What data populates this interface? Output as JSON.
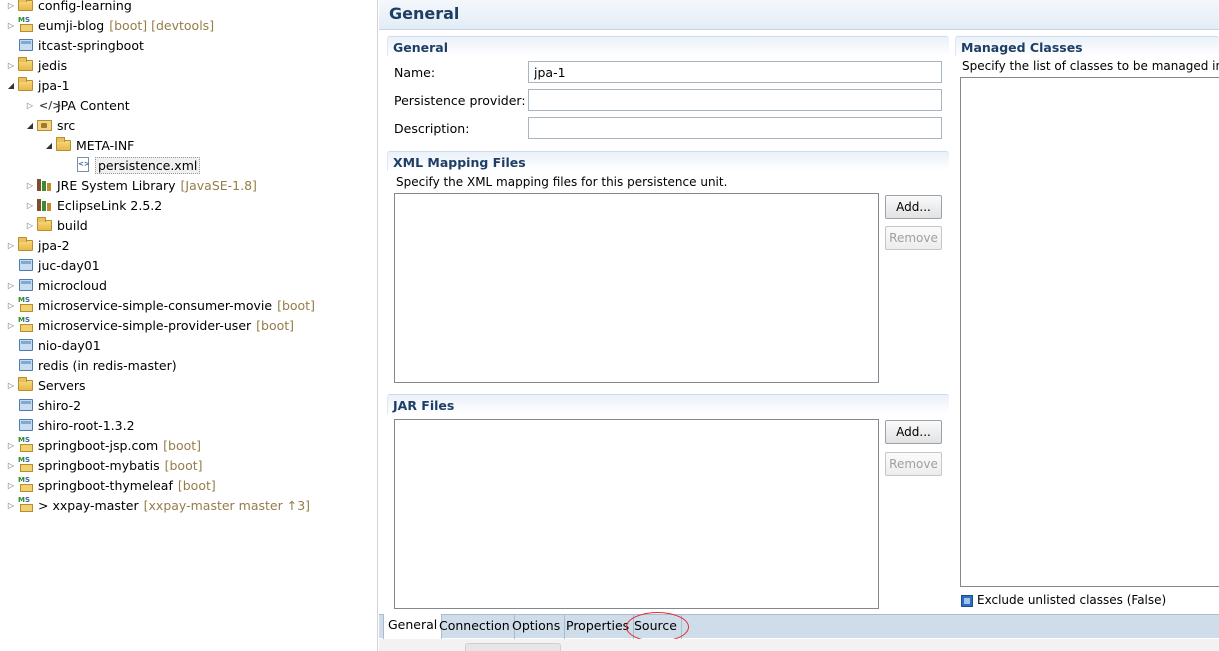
{
  "explorer": {
    "items": [
      {
        "label": "config-learning",
        "decoration": "",
        "icon": "folder-icon",
        "arrow": "collapsed",
        "level": 0
      },
      {
        "label": "eumji-blog",
        "decoration": "[boot] [devtools]",
        "icon": "spring-project-icon",
        "arrow": "collapsed",
        "level": 0
      },
      {
        "label": "itcast-springboot",
        "decoration": "",
        "icon": "project-icon",
        "arrow": "none",
        "level": 0
      },
      {
        "label": "jedis",
        "decoration": "",
        "icon": "folder-icon",
        "arrow": "collapsed",
        "level": 0
      },
      {
        "label": "jpa-1",
        "decoration": "",
        "icon": "folder-icon",
        "arrow": "expanded",
        "level": 0
      },
      {
        "label": "JPA Content",
        "decoration": "",
        "icon": "jpa-content-icon",
        "arrow": "collapsed",
        "level": 1
      },
      {
        "label": "src",
        "decoration": "",
        "icon": "source-folder-icon",
        "arrow": "expanded",
        "level": 1
      },
      {
        "label": "META-INF",
        "decoration": "",
        "icon": "folder-icon",
        "arrow": "expanded",
        "level": 2
      },
      {
        "label": "persistence.xml",
        "decoration": "",
        "icon": "xml-file-icon",
        "arrow": "none",
        "level": 3
      },
      {
        "label": "JRE System Library",
        "decoration": "[JavaSE-1.8]",
        "icon": "library-icon",
        "arrow": "collapsed",
        "level": 1
      },
      {
        "label": "EclipseLink 2.5.2",
        "decoration": "",
        "icon": "library-icon",
        "arrow": "collapsed",
        "level": 1
      },
      {
        "label": "build",
        "decoration": "",
        "icon": "folder-icon",
        "arrow": "collapsed",
        "level": 1
      },
      {
        "label": "jpa-2",
        "decoration": "",
        "icon": "folder-icon",
        "arrow": "collapsed",
        "level": 0
      },
      {
        "label": "juc-day01",
        "decoration": "",
        "icon": "project-icon",
        "arrow": "none",
        "level": 0
      },
      {
        "label": "microcloud",
        "decoration": "",
        "icon": "project-icon",
        "arrow": "collapsed",
        "level": 0
      },
      {
        "label": "microservice-simple-consumer-movie",
        "decoration": "[boot]",
        "icon": "spring-project-icon",
        "arrow": "collapsed",
        "level": 0
      },
      {
        "label": "microservice-simple-provider-user",
        "decoration": "[boot]",
        "icon": "spring-project-icon",
        "arrow": "collapsed",
        "level": 0
      },
      {
        "label": "nio-day01",
        "decoration": "",
        "icon": "project-icon",
        "arrow": "none",
        "level": 0
      },
      {
        "label": "redis (in redis-master)",
        "decoration": "",
        "icon": "project-icon",
        "arrow": "none",
        "level": 0
      },
      {
        "label": "Servers",
        "decoration": "",
        "icon": "folder-icon",
        "arrow": "collapsed",
        "level": 0
      },
      {
        "label": "shiro-2",
        "decoration": "",
        "icon": "project-icon",
        "arrow": "none",
        "level": 0
      },
      {
        "label": "shiro-root-1.3.2",
        "decoration": "",
        "icon": "project-icon",
        "arrow": "none",
        "level": 0
      },
      {
        "label": "springboot-jsp.com",
        "decoration": "[boot]",
        "icon": "spring-project-icon",
        "arrow": "collapsed",
        "level": 0
      },
      {
        "label": "springboot-mybatis",
        "decoration": "[boot]",
        "icon": "spring-project-icon",
        "arrow": "collapsed",
        "level": 0
      },
      {
        "label": "springboot-thymeleaf",
        "decoration": "[boot]",
        "icon": "spring-project-icon",
        "arrow": "collapsed",
        "level": 0
      },
      {
        "label": "xxpay-master",
        "git_prefix": ">",
        "decoration": "[xxpay-master master ↑3]",
        "icon": "git-project-icon",
        "arrow": "collapsed",
        "level": 0
      }
    ],
    "selected_index": 8
  },
  "editor": {
    "title": "General",
    "general": {
      "title": "General",
      "name_label": "Name:",
      "name_value": "jpa-1",
      "provider_label": "Persistence provider:",
      "provider_value": "",
      "description_label": "Description:",
      "description_value": ""
    },
    "xml_mapping": {
      "title": "XML Mapping Files",
      "description": "Specify the XML mapping files for this persistence unit.",
      "add_label": "Add...",
      "remove_label": "Remove"
    },
    "jar_files": {
      "title": "JAR Files",
      "add_label": "Add...",
      "remove_label": "Remove"
    },
    "managed_classes": {
      "title": "Managed Classes",
      "description": "Specify the list of classes to be managed in t",
      "exclude_label": "Exclude unlisted classes (False)"
    },
    "tabs": [
      {
        "label": "General",
        "active": true
      },
      {
        "label": "Connection",
        "active": false
      },
      {
        "label": "Options",
        "active": false
      },
      {
        "label": "Properties",
        "active": false
      },
      {
        "label": "Source",
        "active": false
      }
    ]
  },
  "colors": {
    "section_title": "#1f3e66",
    "decoration": "#957d47",
    "highlight_circle": "#e03030"
  }
}
